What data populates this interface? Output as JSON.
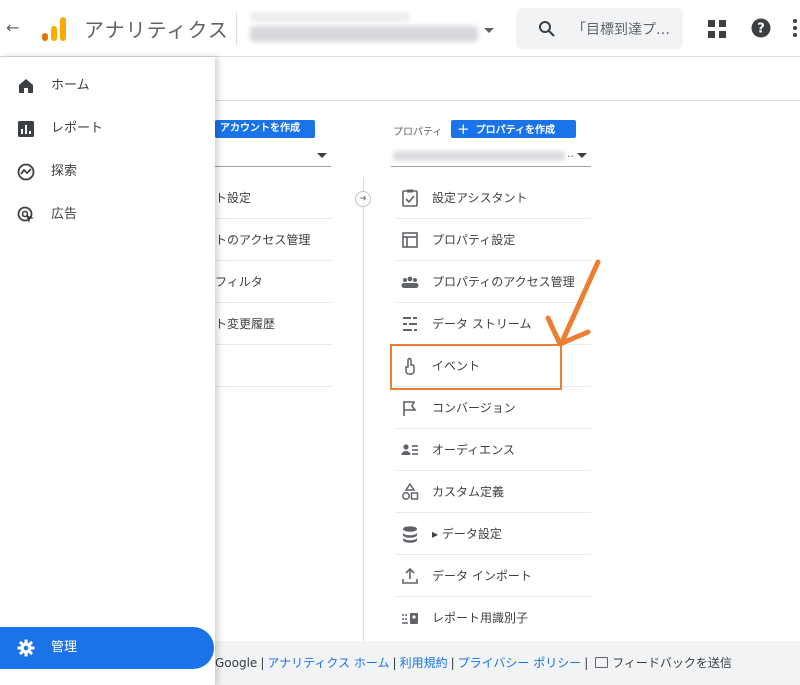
{
  "header": {
    "back_icon": "arrow-back-icon",
    "app_title": "アナリティクス",
    "search_placeholder": "「目標到達プ…",
    "brand_colors": {
      "orange": "#f9ab00",
      "dark_orange": "#e37400"
    }
  },
  "sidebar": {
    "items": [
      {
        "label": "ホーム",
        "icon": "home-icon"
      },
      {
        "label": "レポート",
        "icon": "reports-icon"
      },
      {
        "label": "探索",
        "icon": "explore-icon"
      },
      {
        "label": "広告",
        "icon": "advertising-icon"
      }
    ],
    "admin": {
      "label": "管理",
      "icon": "gear-icon",
      "color": "#1a73e8"
    }
  },
  "account_column": {
    "create_button": "アカウントを作成",
    "items": [
      "ト設定",
      "トのアクセス管理",
      "フィルタ",
      "ト変更履歴"
    ]
  },
  "property_column": {
    "label": "プロパティ",
    "create_button": "プロパティを作成",
    "selector_suffix": "..",
    "items": [
      {
        "label": "設定アシスタント",
        "icon": "checklist-icon"
      },
      {
        "label": "プロパティ設定",
        "icon": "property-settings-icon"
      },
      {
        "label": "プロパティのアクセス管理",
        "icon": "people-icon"
      },
      {
        "label": "データ ストリーム",
        "icon": "data-streams-icon"
      },
      {
        "label": "イベント",
        "icon": "touch-icon"
      },
      {
        "label": "コンバージョン",
        "icon": "flag-icon"
      },
      {
        "label": "オーディエンス",
        "icon": "audience-icon"
      },
      {
        "label": "カスタム定義",
        "icon": "shapes-icon"
      },
      {
        "label": "▸ データ設定",
        "icon": "database-icon"
      },
      {
        "label": "データ インポート",
        "icon": "upload-icon"
      },
      {
        "label": "レポート用識別子",
        "icon": "identity-icon"
      }
    ]
  },
  "annotation": {
    "color": "#ed7d31",
    "highlighted_item": "イベント"
  },
  "footer": {
    "copyright": "Google",
    "links": [
      "アナリティクス ホーム",
      "利用規約",
      "プライバシー ポリシー"
    ],
    "feedback": "フィードバックを送信"
  }
}
